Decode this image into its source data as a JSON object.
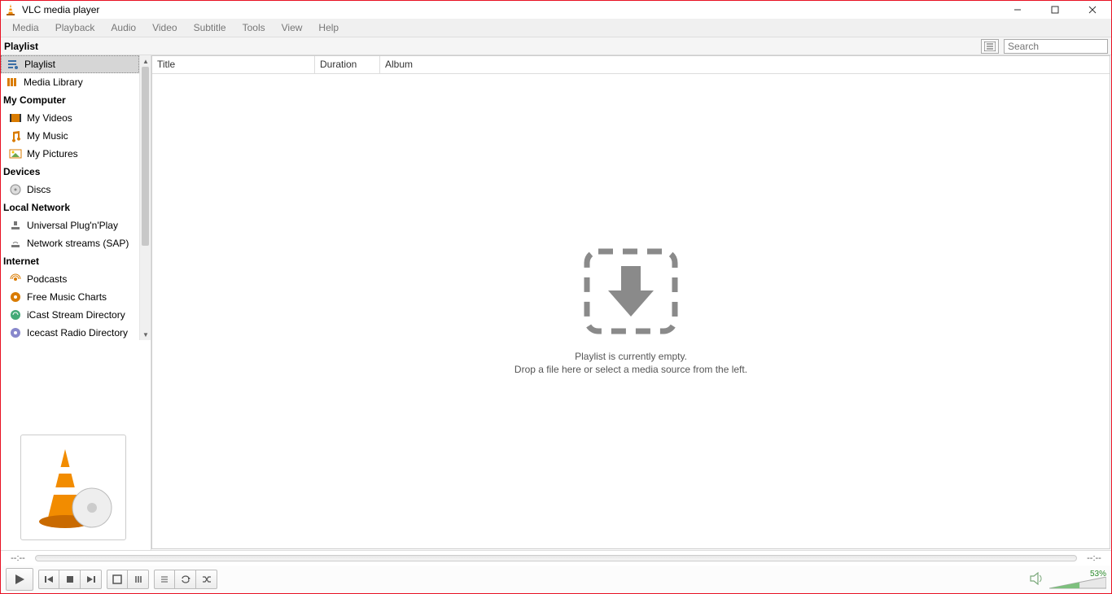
{
  "window": {
    "title": "VLC media player"
  },
  "menu": {
    "items": [
      "Media",
      "Playback",
      "Audio",
      "Video",
      "Subtitle",
      "Tools",
      "View",
      "Help"
    ]
  },
  "header": {
    "title": "Playlist",
    "search_placeholder": "Search"
  },
  "sidebar": {
    "sections": [
      {
        "type": "item",
        "label": "Playlist",
        "icon": "playlist",
        "selected": true
      },
      {
        "type": "item",
        "label": "Media Library",
        "icon": "library"
      },
      {
        "type": "header",
        "label": "My Computer"
      },
      {
        "type": "item",
        "label": "My Videos",
        "icon": "video",
        "indent": true
      },
      {
        "type": "item",
        "label": "My Music",
        "icon": "music",
        "indent": true
      },
      {
        "type": "item",
        "label": "My Pictures",
        "icon": "picture",
        "indent": true
      },
      {
        "type": "header",
        "label": "Devices"
      },
      {
        "type": "item",
        "label": "Discs",
        "icon": "disc",
        "indent": true
      },
      {
        "type": "header",
        "label": "Local Network"
      },
      {
        "type": "item",
        "label": "Universal Plug'n'Play",
        "icon": "upnp",
        "indent": true
      },
      {
        "type": "item",
        "label": "Network streams (SAP)",
        "icon": "sap",
        "indent": true
      },
      {
        "type": "header",
        "label": "Internet"
      },
      {
        "type": "item",
        "label": "Podcasts",
        "icon": "podcast",
        "indent": true
      },
      {
        "type": "item",
        "label": "Free Music Charts",
        "icon": "charts",
        "indent": true
      },
      {
        "type": "item",
        "label": "iCast Stream Directory",
        "icon": "icast",
        "indent": true
      },
      {
        "type": "item",
        "label": "Icecast Radio Directory",
        "icon": "icecast",
        "indent": true
      }
    ]
  },
  "columns": {
    "title": "Title",
    "duration": "Duration",
    "album": "Album"
  },
  "empty": {
    "line1": "Playlist is currently empty.",
    "line2": "Drop a file here or select a media source from the left."
  },
  "time": {
    "elapsed": "--:--",
    "total": "--:--"
  },
  "volume": {
    "percent": "53%",
    "value": 53
  }
}
